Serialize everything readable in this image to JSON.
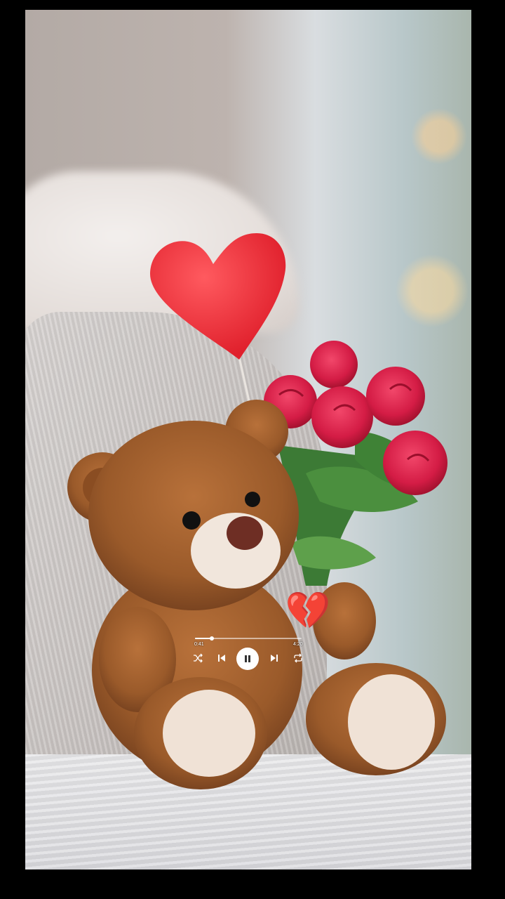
{
  "player": {
    "reaction_icon": "broken-heart-icon",
    "reaction_glyph": "💔",
    "current_time": "0:41",
    "total_time": "4:20",
    "progress": 0.16,
    "controls": [
      "shuffle-icon",
      "previous-icon",
      "pause-icon",
      "next-icon",
      "repeat-icon"
    ]
  },
  "colors": {
    "accent": "#ffffff",
    "heart": "#e8202a"
  }
}
